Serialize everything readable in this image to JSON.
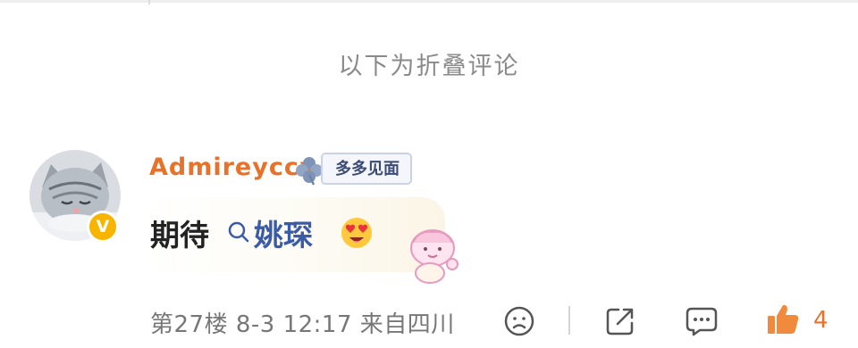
{
  "folded_section": {
    "title": "以下为折叠评论"
  },
  "comment": {
    "username": "Admireyccx",
    "fan_badge": "多多见面",
    "text_prefix": "期待",
    "topic": "姚琛",
    "meta": "第27楼 8-3 12:17 来自四川",
    "like_count": "4",
    "icons": {
      "verified": "verified-badge-icon",
      "badge": "clover-icon",
      "search": "search-icon",
      "emoji": "heart-eyes-emoji",
      "sticker": "baby-sticker",
      "dislike": "sad-face-icon",
      "share": "share-icon",
      "reply": "comment-icon",
      "like": "thumbs-up-icon"
    },
    "colors": {
      "username": "#e8722a",
      "topic": "#3a5ba8",
      "like": "#e8722a",
      "verified": "#f7b500"
    }
  }
}
